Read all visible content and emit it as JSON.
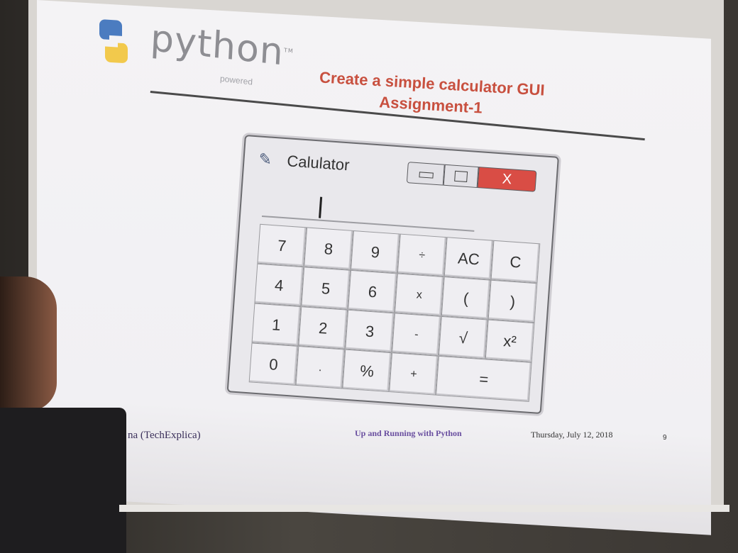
{
  "slide": {
    "logo_text": "python",
    "logo_tm": "TM",
    "logo_sub": "powered",
    "title_line1": "Create a simple calculator GUI",
    "title_line2": "Assignment-1"
  },
  "calculator": {
    "window_title": "Calulator",
    "close_glyph": "X",
    "keys": [
      [
        "7",
        "8",
        "9",
        "÷",
        "AC",
        "C"
      ],
      [
        "4",
        "5",
        "6",
        "x",
        "(",
        ")"
      ],
      [
        "1",
        "2",
        "3",
        "-",
        "√",
        "x²"
      ],
      [
        "0",
        ".",
        "%",
        "+",
        "="
      ]
    ]
  },
  "footer": {
    "author": "na (TechExplica)",
    "course": "Up and Running with Python",
    "date": "Thursday, July 12, 2018",
    "page": "9"
  },
  "colors": {
    "title": "#c8503f",
    "close_button": "#d94d45",
    "footer_course": "#6a4fa0"
  }
}
